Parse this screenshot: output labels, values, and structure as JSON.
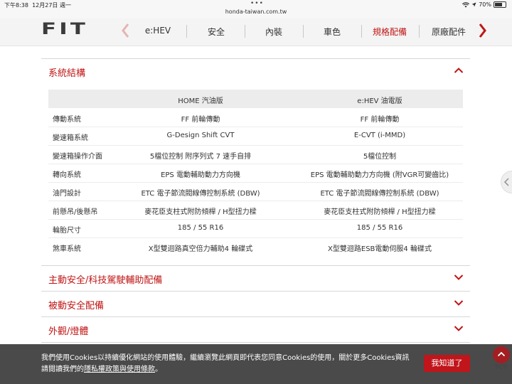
{
  "status_bar": {
    "time": "下午8:38",
    "date": "12月27日 週一",
    "url": "honda-taiwan.com.tw",
    "battery": "70%",
    "battery_level": 0.7
  },
  "nav": {
    "logo": "FIT",
    "items": [
      {
        "label": "e:HEV"
      },
      {
        "label": "安全"
      },
      {
        "label": "內裝"
      },
      {
        "label": "車色"
      },
      {
        "label": "規格配備"
      },
      {
        "label": "原廠配件"
      }
    ],
    "active_index": 4,
    "accent": "#c01515"
  },
  "sections": [
    {
      "title": "系統結構",
      "expanded": true
    },
    {
      "title": "主動安全/科技駕駛輔助配備",
      "expanded": false
    },
    {
      "title": "被動安全配備",
      "expanded": false
    },
    {
      "title": "外觀/燈體",
      "expanded": false
    }
  ],
  "spec_table": {
    "columns": [
      "",
      "HOME 汽油版",
      "e:HEV 油電版"
    ],
    "rows": [
      [
        "傳動系統",
        "FF 前輪傳動",
        "FF 前輪傳動"
      ],
      [
        "變速箱系統",
        "G-Design Shift CVT",
        "E-CVT (i-MMD)"
      ],
      [
        "變速箱操作介面",
        "5檔位控制 附序列式 7 速手自排",
        "5檔位控制"
      ],
      [
        "轉向系統",
        "EPS 電動輔助動力方向機",
        "EPS 電動輔助動力方向機 (附VGR可變齒比)"
      ],
      [
        "油門設計",
        "ETC 電子節流閥線傳控制系統 (DBW)",
        "ETC 電子節流閥線傳控制系統 (DBW)"
      ],
      [
        "前懸吊/後懸吊",
        "麥花臣支柱式附防傾桿 / H型扭力樑",
        "麥花臣支柱式附防傾桿 / H型扭力樑"
      ],
      [
        "輪胎尺寸",
        "185 / 55 R16",
        "185 / 55 R16"
      ],
      [
        "煞車系統",
        "X型雙迴路真空倍力輔助4 輪碟式",
        "X型雙迴路ESB電動伺服4 輪碟式"
      ]
    ]
  },
  "cookie_banner": {
    "line1": "我們使用Cookies以持續優化網站的使用體驗，繼續瀏覽此網頁即代表您同意Cookies的使用，關於更多Cookies資訊",
    "line2_prefix": "請閱讀我們的",
    "link_text": "隱私權政策與使用條款",
    "line2_suffix": "。",
    "button": "我知道了"
  },
  "top_button": {
    "label": "TOP"
  }
}
